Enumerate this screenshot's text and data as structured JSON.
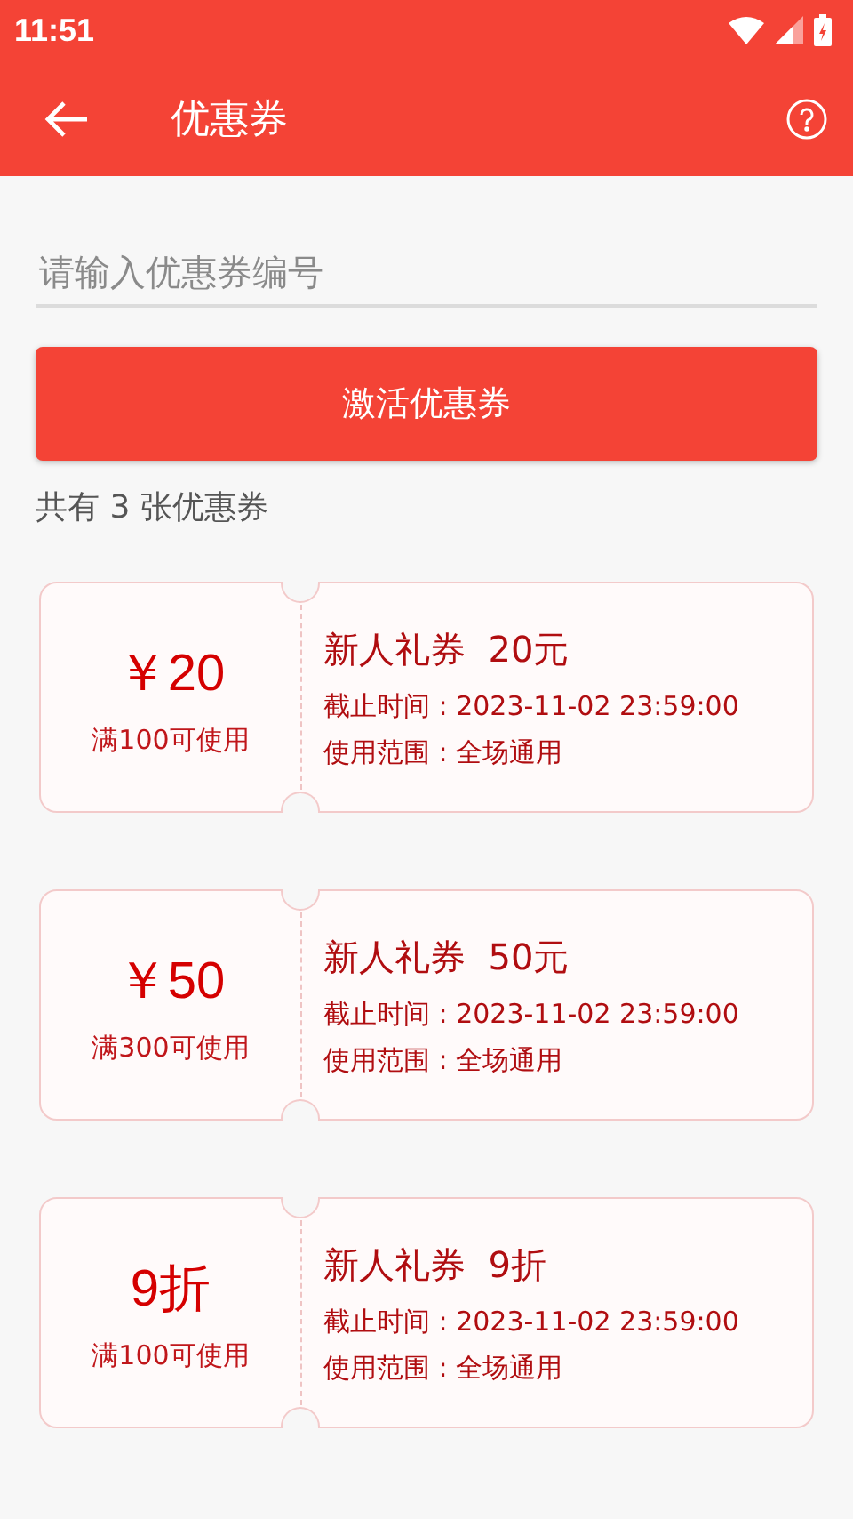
{
  "status_bar": {
    "time": "11:51"
  },
  "app_bar": {
    "title": "优惠券"
  },
  "code_input": {
    "placeholder": "请输入优惠券编号"
  },
  "activate_button": "激活优惠券",
  "count_text": "共有 3 张优惠券",
  "coupons": [
    {
      "amount": "￥20",
      "condition": "满100可使用",
      "name": "新人礼券  20元",
      "deadline": "截止时间 : 2023-11-02 23:59:00",
      "scope": "使用范围 : 全场通用"
    },
    {
      "amount": "￥50",
      "condition": "满300可使用",
      "name": "新人礼券  50元",
      "deadline": "截止时间 : 2023-11-02 23:59:00",
      "scope": "使用范围 : 全场通用"
    },
    {
      "amount": "9折",
      "condition": "满100可使用",
      "name": "新人礼券  9折",
      "deadline": "截止时间 : 2023-11-02 23:59:00",
      "scope": "使用范围 : 全场通用"
    }
  ]
}
